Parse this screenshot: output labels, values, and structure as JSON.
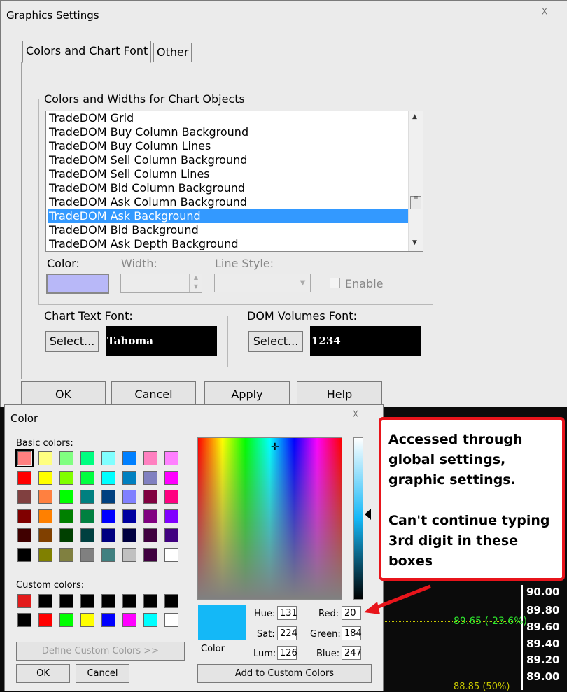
{
  "dialog": {
    "title": "Graphics Settings",
    "close_symbol": "☓",
    "tabs": [
      "Colors and Chart Font",
      "Other"
    ],
    "group_title": "Colors and Widths for Chart Objects",
    "list_items": [
      "TradeDOM Grid",
      "TradeDOM Buy Column Background",
      "TradeDOM Buy Column Lines",
      "TradeDOM Sell Column Background",
      "TradeDOM Sell Column Lines",
      "TradeDOM Bid Column Background",
      "TradeDOM Ask Column Background",
      "TradeDOM Ask Background",
      "TradeDOM Bid Background",
      "TradeDOM Ask Depth Background"
    ],
    "selected_index": 7,
    "color_label": "Color:",
    "width_label": "Width:",
    "line_style_label": "Line Style:",
    "enable_label": "Enable",
    "swatch_color": "#b8b8f8",
    "chart_text_font_label": "Chart Text Font:",
    "dom_volumes_font_label": "DOM Volumes Font:",
    "select_label": "Select...",
    "chart_text_font_value": "Tahoma",
    "dom_volumes_font_value": "1234",
    "buttons": {
      "ok": "OK",
      "cancel": "Cancel",
      "apply": "Apply",
      "help": "Help"
    }
  },
  "color_dialog": {
    "title": "Color",
    "close_symbol": "☓",
    "basic_colors_label": "Basic colors:",
    "custom_colors_label": "Custom colors:",
    "basic_colors": [
      [
        "#ff8080",
        "#ffff80",
        "#80ff80",
        "#00ff80",
        "#80ffff",
        "#0080ff",
        "#ff80c0",
        "#ff80ff"
      ],
      [
        "#ff0000",
        "#ffff00",
        "#80ff00",
        "#00ff40",
        "#00ffff",
        "#0080c0",
        "#8080c0",
        "#ff00ff"
      ],
      [
        "#804040",
        "#ff8040",
        "#00ff00",
        "#008080",
        "#004080",
        "#8080ff",
        "#800040",
        "#ff0080"
      ],
      [
        "#800000",
        "#ff8000",
        "#008000",
        "#008040",
        "#0000ff",
        "#0000a0",
        "#800080",
        "#8000ff"
      ],
      [
        "#400000",
        "#804000",
        "#004000",
        "#004040",
        "#000080",
        "#000040",
        "#400040",
        "#400080"
      ],
      [
        "#000000",
        "#808000",
        "#808040",
        "#808080",
        "#408080",
        "#c0c0c0",
        "#400040",
        "#ffffff"
      ]
    ],
    "custom_colors": [
      [
        "#e31b1b",
        "#000000",
        "#000000",
        "#000000",
        "#000000",
        "#000000",
        "#000000",
        "#000000"
      ],
      [
        "#000000",
        "#ff0000",
        "#00ff00",
        "#ffff00",
        "#0000ff",
        "#ff00ff",
        "#00ffff",
        "#ffffff"
      ]
    ],
    "define_custom_label": "Define Custom Colors >>",
    "ok": "OK",
    "cancel": "Cancel",
    "preview_color": "#14b8f7",
    "color_caption": "Color",
    "hue_label": "Hue:",
    "hue": "131",
    "sat_label": "Sat:",
    "sat": "224",
    "lum_label": "Lum:",
    "lum": "126",
    "red_label": "Red:",
    "red": "20",
    "green_label": "Green:",
    "green": "184",
    "blue_label": "Blue:",
    "blue": "247",
    "add_custom_label": "Add to Custom Colors"
  },
  "callout": {
    "line1": "Accessed through",
    "line2": "global settings,",
    "line3": "graphic settings.",
    "line4": "Can't continue typing",
    "line5": "3rd digit in these",
    "line6": "boxes"
  },
  "chart": {
    "prices": [
      "90.00",
      "89.80",
      "89.60",
      "89.40",
      "89.20",
      "89.00"
    ],
    "fib_label": "89.65  (-23.6%)",
    "fib_label2": "88.85  (50%)",
    "accent": "#e8141b"
  }
}
